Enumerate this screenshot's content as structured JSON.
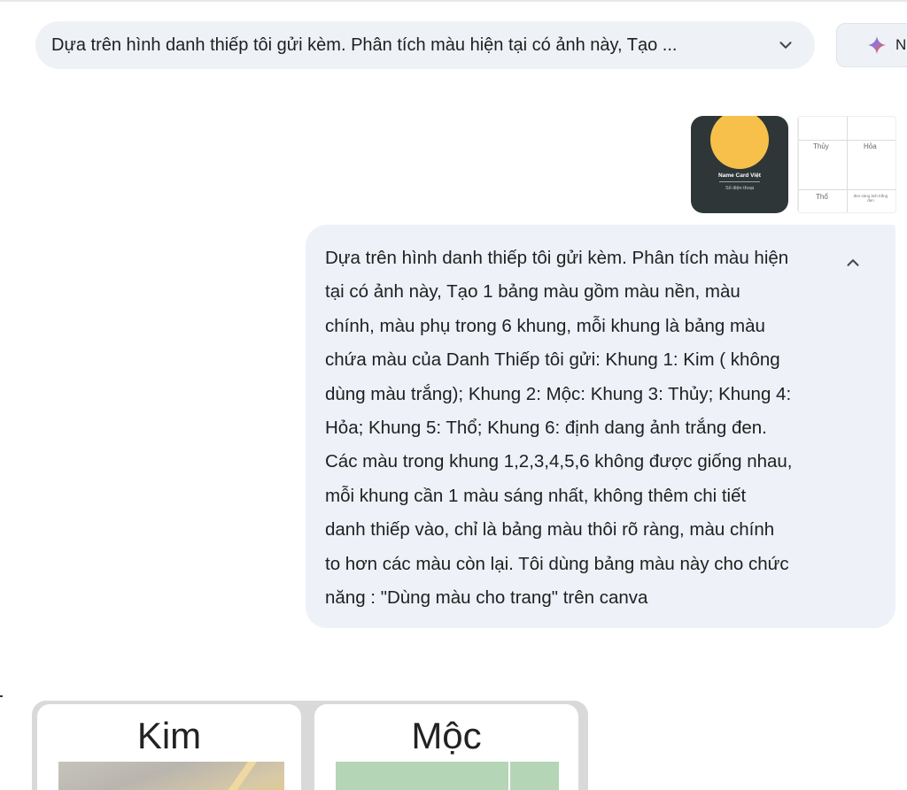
{
  "header": {
    "prompt_summary": "Dựa trên hình danh thiếp tôi gửi kèm. Phân tích màu hiện tại có ảnh này, Tạo ...",
    "new_button_label": "Na"
  },
  "attachments": {
    "name_card": {
      "brand": "Name Card Việt",
      "phone_label": "Số điện thoại",
      "colors": {
        "background": "#2e3638",
        "sun": "#f6c04a"
      }
    },
    "palette_grid": {
      "cells": [
        "Thủy",
        "Hỏa",
        "Thổ",
        "đen sáng ảnh trắng đen"
      ]
    }
  },
  "user_message": {
    "text": "Dựa trên hình danh thiếp tôi gửi kèm. Phân tích màu hiện\ntại có ảnh này, Tạo 1 bảng màu gồm màu nền, màu\nchính, màu phụ trong 6 khung, mỗi khung là bảng màu\nchứa màu của Danh Thiếp tôi gửi: Khung 1: Kim ( không\ndùng màu trắng); Khung 2: Mộc: Khung 3: Thủy; Khung 4:\nHỏa; Khung 5: Thổ; Khung 6: định dang ảnh trắng đen.\nCác màu trong khung 1,2,3,4,5,6 không được giống nhau,\nmỗi khung cần 1 màu sáng nhất, không thêm chi tiết\ndanh thiếp vào, chỉ là bảng màu thôi rõ ràng, màu chính\nto hơn các màu còn lại. Tôi dùng bảng màu này cho chức\nnăng : \"Dùng màu cho trang\" trên canva"
  },
  "response_preview": {
    "panels": [
      {
        "title": "Kim"
      },
      {
        "title": "Mộc"
      }
    ]
  },
  "colors": {
    "pill_bg": "#eef1f6",
    "bubble_bg": "#eef1f8",
    "moc_green": "#b4d6b6"
  }
}
